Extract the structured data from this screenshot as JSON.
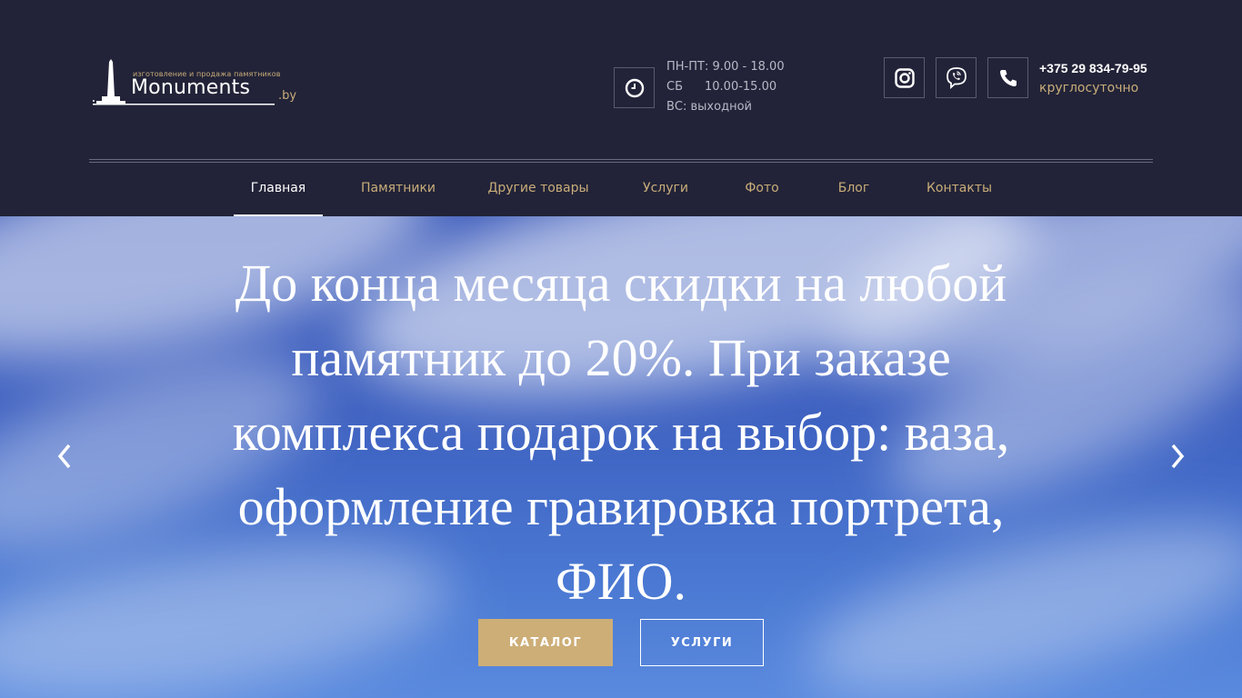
{
  "logo": {
    "tagline": "изготовление и продажа памятников",
    "name": "Monuments",
    "domain": ".by"
  },
  "hours": {
    "weekdays": "ПН-ПТ: 9.00 - 18.00",
    "saturday_label": "СБ",
    "saturday_time": "10.00-15.00",
    "sunday": "ВС: выходной"
  },
  "contact": {
    "phone": "+375 29 834-79-95",
    "note": "круглосуточно"
  },
  "nav": {
    "items": [
      "Главная",
      "Памятники",
      "Другие товары",
      "Услуги",
      "Фото",
      "Блог",
      "Контакты"
    ],
    "active": "Главная"
  },
  "hero": {
    "line1": "До конца месяца скидки на любой",
    "line2": "памятник до 20%. При заказе",
    "line3": "комплекса подарок на выбор: ваза,",
    "line4": "оформление гравировка портрета,",
    "line5": "ФИО.",
    "catalog_button": "КАТАЛОГ",
    "services_button": "УСЛУГИ"
  },
  "icons": {
    "clock": "clock-icon",
    "instagram": "instagram-icon",
    "viber": "viber-icon",
    "phone": "phone-icon",
    "prev": "chevron-left-icon",
    "next": "chevron-right-icon"
  },
  "colors": {
    "header_bg": "#222338",
    "accent": "#c9ad7a",
    "button": "#cdae77"
  }
}
